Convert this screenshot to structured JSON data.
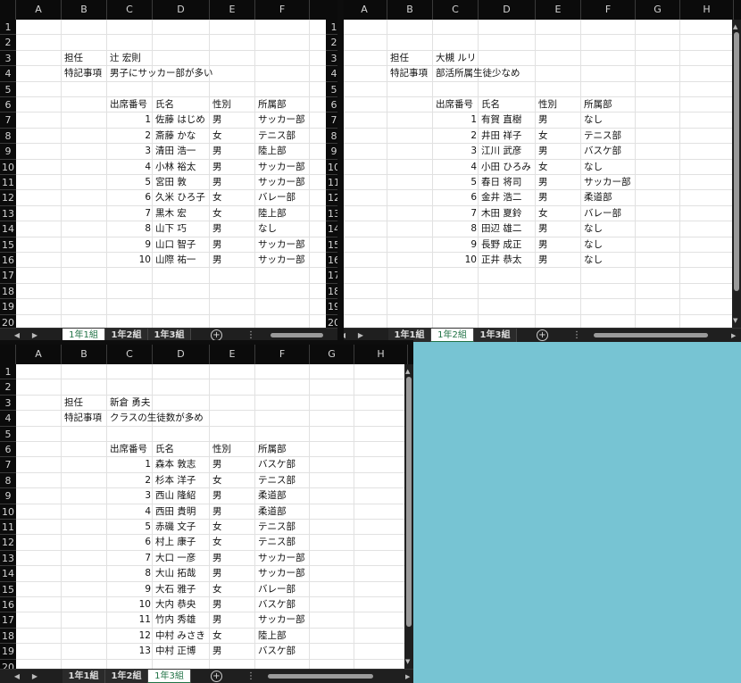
{
  "columns": [
    "A",
    "B",
    "C",
    "D",
    "E",
    "F",
    "G",
    "H"
  ],
  "label_tanin": "担任",
  "label_tokki": "特記事項",
  "header_row": [
    "出席番号",
    "氏名",
    "性別",
    "所属部"
  ],
  "tabs": [
    "1年1組",
    "1年2組",
    "1年3組"
  ],
  "nav_prev": "◀",
  "nav_next": "▶",
  "add_sheet": "+",
  "more": "⋮",
  "scroll_left": "◀",
  "scroll_right": "▶",
  "scroll_up": "▲",
  "scroll_down": "▼",
  "sheets": [
    {
      "teacher": "辻 宏則",
      "note": "男子にサッカー部が多い",
      "students": [
        {
          "no": "1",
          "name": "佐藤 はじめ",
          "sex": "男",
          "club": "サッカー部"
        },
        {
          "no": "2",
          "name": "斎藤 かな",
          "sex": "女",
          "club": "テニス部"
        },
        {
          "no": "3",
          "name": "清田 浩一",
          "sex": "男",
          "club": "陸上部"
        },
        {
          "no": "4",
          "name": "小林 裕太",
          "sex": "男",
          "club": "サッカー部"
        },
        {
          "no": "5",
          "name": "宮田 敦",
          "sex": "男",
          "club": "サッカー部"
        },
        {
          "no": "6",
          "name": "久米 ひろ子",
          "sex": "女",
          "club": "バレー部"
        },
        {
          "no": "7",
          "name": "黒木 宏",
          "sex": "女",
          "club": "陸上部"
        },
        {
          "no": "8",
          "name": "山下 巧",
          "sex": "男",
          "club": "なし"
        },
        {
          "no": "9",
          "name": "山口 智子",
          "sex": "男",
          "club": "サッカー部"
        },
        {
          "no": "10",
          "name": "山際 祐一",
          "sex": "男",
          "club": "サッカー部"
        }
      ]
    },
    {
      "teacher": "大槻 ルリ",
      "note": "部活所属生徒少なめ",
      "students": [
        {
          "no": "1",
          "name": "有賀 直樹",
          "sex": "男",
          "club": "なし"
        },
        {
          "no": "2",
          "name": "井田 祥子",
          "sex": "女",
          "club": "テニス部"
        },
        {
          "no": "3",
          "name": "江川 武彦",
          "sex": "男",
          "club": "バスケ部"
        },
        {
          "no": "4",
          "name": "小田 ひろみ",
          "sex": "女",
          "club": "なし"
        },
        {
          "no": "5",
          "name": "春日 将司",
          "sex": "男",
          "club": "サッカー部"
        },
        {
          "no": "6",
          "name": "金井 浩二",
          "sex": "男",
          "club": "柔道部"
        },
        {
          "no": "7",
          "name": "木田 夏鈴",
          "sex": "女",
          "club": "バレー部"
        },
        {
          "no": "8",
          "name": "田辺 雄二",
          "sex": "男",
          "club": "なし"
        },
        {
          "no": "9",
          "name": "長野 成正",
          "sex": "男",
          "club": "なし"
        },
        {
          "no": "10",
          "name": "正井 恭太",
          "sex": "男",
          "club": "なし"
        }
      ]
    },
    {
      "teacher": "新倉 勇夫",
      "note": "クラスの生徒数が多め",
      "students": [
        {
          "no": "1",
          "name": "森本 敦志",
          "sex": "男",
          "club": "バスケ部"
        },
        {
          "no": "2",
          "name": "杉本 洋子",
          "sex": "女",
          "club": "テニス部"
        },
        {
          "no": "3",
          "name": "西山 隆紹",
          "sex": "男",
          "club": "柔道部"
        },
        {
          "no": "4",
          "name": "西田 貴明",
          "sex": "男",
          "club": "柔道部"
        },
        {
          "no": "5",
          "name": "赤磯 文子",
          "sex": "女",
          "club": "テニス部"
        },
        {
          "no": "6",
          "name": "村上 康子",
          "sex": "女",
          "club": "テニス部"
        },
        {
          "no": "7",
          "name": "大口 一彦",
          "sex": "男",
          "club": "サッカー部"
        },
        {
          "no": "8",
          "name": "大山 拓哉",
          "sex": "男",
          "club": "サッカー部"
        },
        {
          "no": "9",
          "name": "大石 雅子",
          "sex": "女",
          "club": "バレー部"
        },
        {
          "no": "10",
          "name": "大内 恭央",
          "sex": "男",
          "club": "バスケ部"
        },
        {
          "no": "11",
          "name": "竹内 秀雄",
          "sex": "男",
          "club": "サッカー部"
        },
        {
          "no": "12",
          "name": "中村 みさき",
          "sex": "女",
          "club": "陸上部"
        },
        {
          "no": "13",
          "name": "中村 正博",
          "sex": "男",
          "club": "バスケ部"
        }
      ]
    }
  ]
}
